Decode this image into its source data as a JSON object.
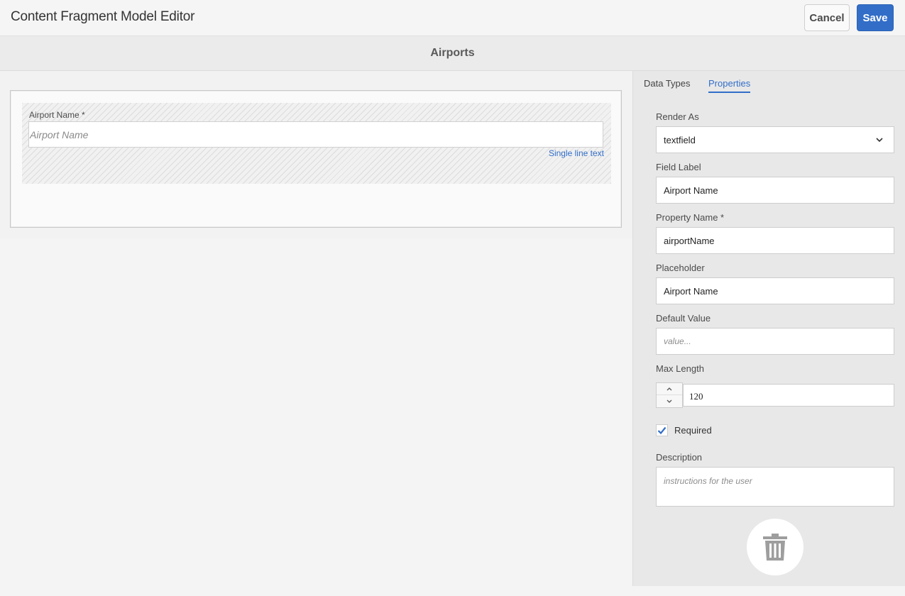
{
  "header": {
    "app_title": "Content Fragment Model Editor",
    "cancel_label": "Cancel",
    "save_label": "Save",
    "accent_color": "#326ec8"
  },
  "model": {
    "title": "Airports"
  },
  "canvas": {
    "field": {
      "label": "Airport Name *",
      "placeholder": "Airport Name",
      "type_label": "Single line text"
    }
  },
  "sidebar": {
    "tabs": [
      {
        "label": "Data Types",
        "active": false
      },
      {
        "label": "Properties",
        "active": true
      }
    ],
    "properties": {
      "render_as_label": "Render As",
      "render_as_value": "textfield",
      "field_label_label": "Field Label",
      "field_label_value": "Airport Name",
      "property_name_label": "Property Name *",
      "property_name_value": "airportName",
      "placeholder_label": "Placeholder",
      "placeholder_value": "Airport Name",
      "default_value_label": "Default Value",
      "default_value_placeholder": "value...",
      "max_length_label": "Max Length",
      "max_length_value": "120",
      "required_label": "Required",
      "required_checked": true,
      "description_label": "Description",
      "description_placeholder": "instructions for the user"
    },
    "icons": {
      "render_as_dropdown": "chevron-down-icon",
      "stepper_up": "chevron-up-icon",
      "stepper_down": "chevron-down-icon",
      "required_check": "checkmark-icon",
      "delete": "trash-icon"
    }
  }
}
